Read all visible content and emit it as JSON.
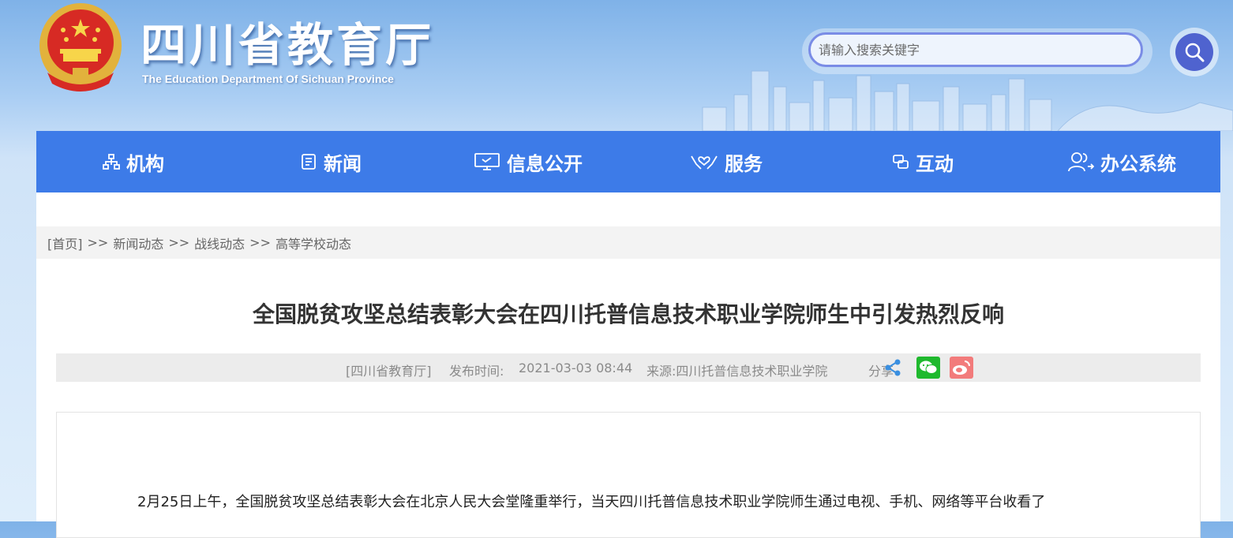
{
  "header": {
    "title": "四川省教育厅",
    "subtitle": "The Education Department Of Sichuan Province",
    "search_placeholder": "请输入搜索关键字"
  },
  "nav": {
    "items": [
      {
        "label": "机构",
        "icon": "org-chart-icon"
      },
      {
        "label": "新闻",
        "icon": "document-icon"
      },
      {
        "label": "信息公开",
        "icon": "monitor-icon"
      },
      {
        "label": "服务",
        "icon": "hands-heart-icon"
      },
      {
        "label": "互动",
        "icon": "chat-icon"
      },
      {
        "label": "办公系统",
        "icon": "users-icon"
      }
    ]
  },
  "breadcrumb": {
    "items": [
      "[首页]",
      "新闻动态",
      "战线动态",
      "高等学校动态"
    ],
    "separator": ">>"
  },
  "article": {
    "title": "全国脱贫攻坚总结表彰大会在四川托普信息技术职业学院师生中引发热烈反响",
    "meta": {
      "source_site": "[四川省教育厅]",
      "publish_label": "发布时间:",
      "publish_time": "2021-03-03 08:44",
      "source": "来源:四川托普信息技术职业学院",
      "share_label": "分享"
    },
    "paragraph": "2月25日上午，全国脱贫攻坚总结表彰大会在北京人民大会堂隆重举行，当天四川托普信息技术职业学院师生通过电视、手机、网络等平台收看了"
  },
  "colors": {
    "nav_bg": "#3d7be8",
    "wechat": "#1fb92e",
    "weibo": "#f27b7b",
    "search_btn": "#4f63cf"
  }
}
